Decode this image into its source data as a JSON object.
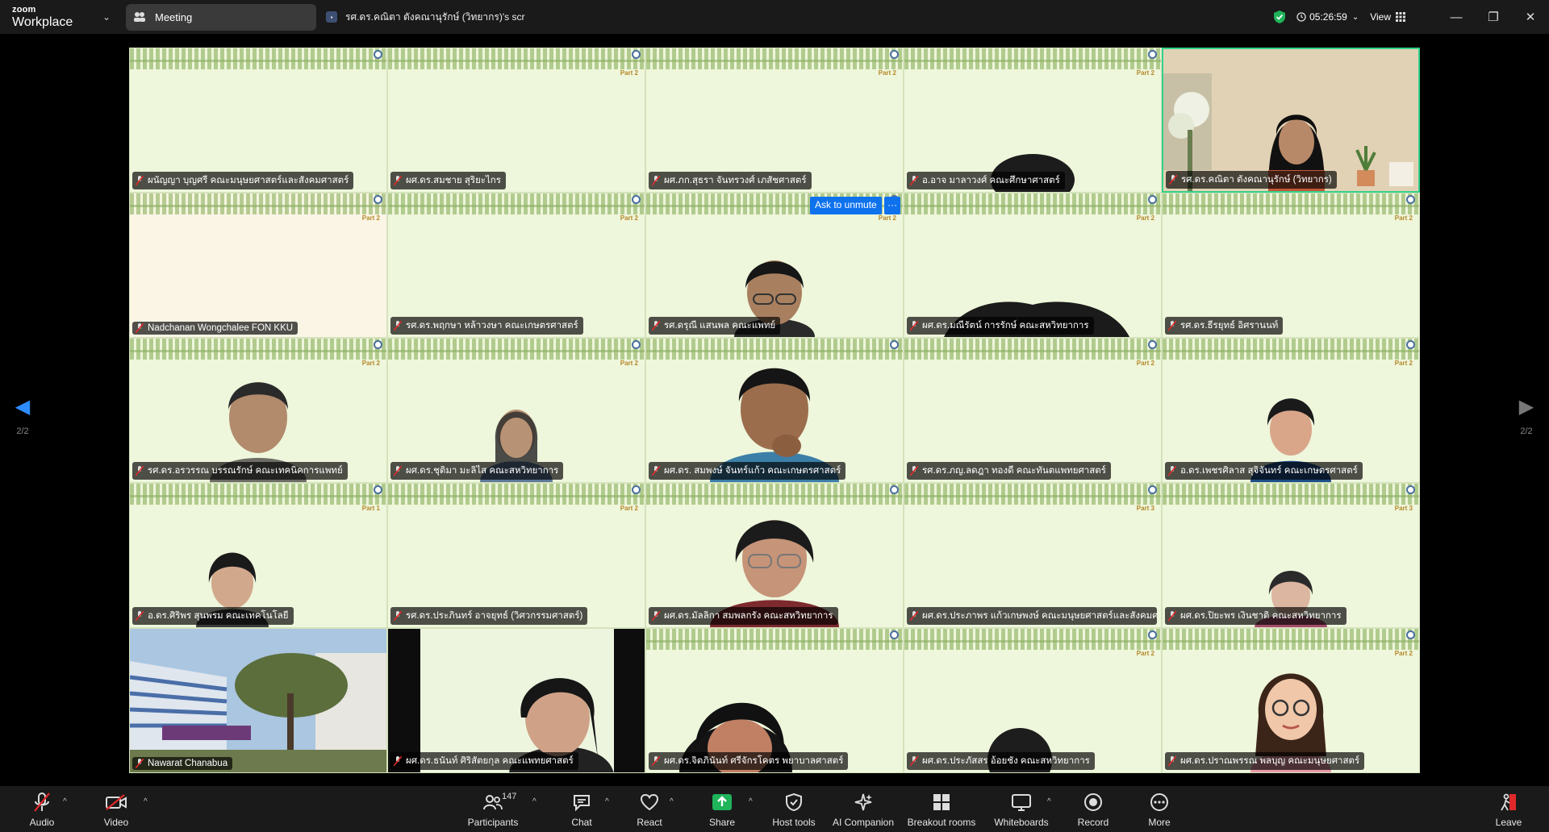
{
  "titlebar": {
    "brand_top": "zoom",
    "brand_bottom": "Workplace",
    "meeting_tab": "Meeting",
    "share_tab": "รศ.ดร.คณิตา ตังคณานุรักษ์ (วิทยากร)'s scr",
    "timer": "05:26:59",
    "view_label": "View"
  },
  "ask_unmute": "Ask to unmute",
  "ask_more": "···",
  "page_nav": {
    "label": "2/2"
  },
  "tiles": [
    "ผนัญญา บุญศรี คณะมนุษยศาสตร์และสังคมศาสตร์",
    "ผศ.ดร.สมชาย สุริยะไกร",
    "ผศ.ภก.สุธรา จันทรวงศ์ เภสัชศาสตร์",
    "อ.อาจ มาลาวงศ์ คณะศึกษาศาสตร์",
    "รศ.ดร.คณิตา ตังคณานุรักษ์ (วิทยากร)",
    "Nadchanan Wongchalee FON KKU",
    "รศ.ดร.พฤกษา หล้าวงษา คณะเกษตรศาสตร์",
    "รศ.ดรุณี แสนพล คณะแพทย์",
    "ผศ.ดร.มณีรัตน์ การรักษ์ คณะสหวิทยาการ",
    "รศ.ดร.ธีรยุทธ์ อิศรานนท์",
    "รศ.ดร.อรวรรณ บรรณรักษ์ คณะเทคนิคการแพทย์",
    "ผศ.ดร.ชุติมา มะลิไส คณะสหวิทยาการ",
    "ผศ.ดร. สมพงษ์ จันทร์แก้ว คณะเกษตรศาสตร์",
    "รศ.ดร.ภญ.ลดฎา ทองดี คณะทันตแพทยศาสตร์",
    "อ.ดร.เพชรศิลาส สุจิจันทร์ คณะเกษตรศาสตร์",
    "อ.ดร.ศิริพร สุนพรม คณะเทคโนโลยี",
    "รศ.ดร.ประภินทร์ อาจยุทธ์ (วิศวกรรมศาสตร์)",
    "ผศ.ดร.มัลลิกา สมพลกรัง คณะสหวิทยาการ",
    "ผศ.ดร.ประภาพร แก้วเกษพงษ์ คณะมนุษยศาสตร์และสังคมศา...",
    "ผศ.ดร.ปิยะพร เงินชาติ คณะสหวิทยาการ",
    "Nawarat Chanabua",
    "ผศ.ดร.ธนันท์ ศิริสัตยกุล คณะแพทยศาสตร์",
    "ผศ.ดร.จิตภินันท์ ศรีจักรโคตร พยาบาลศาสตร์",
    "ผศ.ดร.ประภัสสร อ้อยชัง คณะสหวิทยาการ",
    "ผศ.ดร.ปราณพรรณ พลบุญ คณะมนุษยศาสตร์"
  ],
  "toolbar": {
    "audio": "Audio",
    "video": "Video",
    "participants": "Participants",
    "participants_count": "147",
    "chat": "Chat",
    "react": "React",
    "share": "Share",
    "host_tools": "Host tools",
    "ai_companion": "AI Companion",
    "breakout_rooms": "Breakout rooms",
    "whiteboards": "Whiteboards",
    "record": "Record",
    "more": "More",
    "leave": "Leave"
  }
}
